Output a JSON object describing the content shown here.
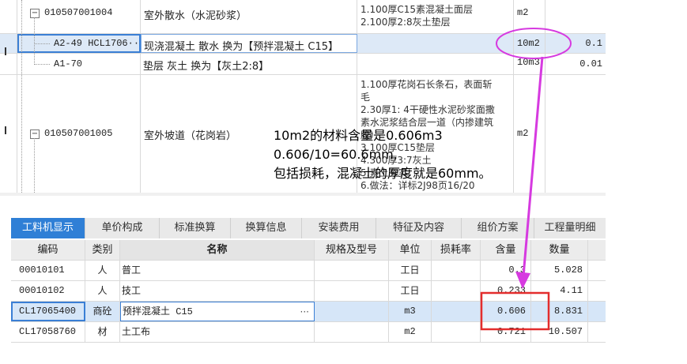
{
  "upper": {
    "rows": [
      {
        "code": "010507001004",
        "name": "室外散水（水泥砂浆）",
        "features": [
          "1.100厚C15素混凝土面层",
          "2.100厚2:8灰土垫层"
        ],
        "unit": "m2",
        "qty": ""
      },
      {
        "code": "A2-49  HCL1706···",
        "name": "现浇混凝土 散水  换为【预拌混凝土 C15】",
        "features": [],
        "unit": "10m2",
        "qty": "0.1"
      },
      {
        "code": "A1-70",
        "name": "垫层 灰土  换为【灰土2:8】",
        "features": [],
        "unit": "10m3",
        "qty": "0.01"
      },
      {
        "code": "010507001005",
        "name": "室外坡道（花岗岩）",
        "features": [
          "1.100厚花岗石长条石，表面斩",
          "毛",
          "2.30厚1: 4干硬性水泥砂浆面撒",
          "素水泥浆结合层一道（内掺建筑",
          "胶）",
          "3.100厚C15垫层",
          "4.300厚3:7灰土",
          "5.素土夯实",
          "6.做法：详标2J98页16/20"
        ],
        "unit": "m2",
        "qty": ""
      }
    ]
  },
  "tabs": [
    "工料机显示",
    "单价构成",
    "标准换算",
    "换算信息",
    "安装费用",
    "特征及内容",
    "组价方案",
    "工程量明细"
  ],
  "lower": {
    "headers": {
      "code": "编码",
      "type": "类别",
      "name": "名称",
      "spec": "规格及型号",
      "unit": "单位",
      "loss": "损耗率",
      "content": "含量",
      "qty": "数量"
    },
    "rows": [
      {
        "code": "00010101",
        "type": "人",
        "name": "普工",
        "spec": "",
        "unit": "工日",
        "loss": "",
        "content": "0.3",
        "qty": "5.028"
      },
      {
        "code": "00010102",
        "type": "人",
        "name": "技工",
        "spec": "",
        "unit": "工日",
        "loss": "",
        "content": "0.233",
        "qty": "4.11"
      },
      {
        "code": "CL17065400",
        "type": "商砼",
        "name": "预拌混凝土 C15",
        "spec": "",
        "unit": "m3",
        "loss": "",
        "content": "0.606",
        "qty": "8.831"
      },
      {
        "code": "CL17058760",
        "type": "材",
        "name": "土工布",
        "spec": "",
        "unit": "m2",
        "loss": "",
        "content": "0.721",
        "qty": "10.507"
      }
    ]
  },
  "annotation": {
    "lines": [
      "10m2的材料含量是0.606m3",
      "0.606/10=60.6mm,",
      "包括损耗，混凝土的厚度就是60mm。"
    ],
    "colors": {
      "arrow": "#d63ae0",
      "ellipse": "#d63ae0",
      "box": "#e32d2d"
    }
  }
}
